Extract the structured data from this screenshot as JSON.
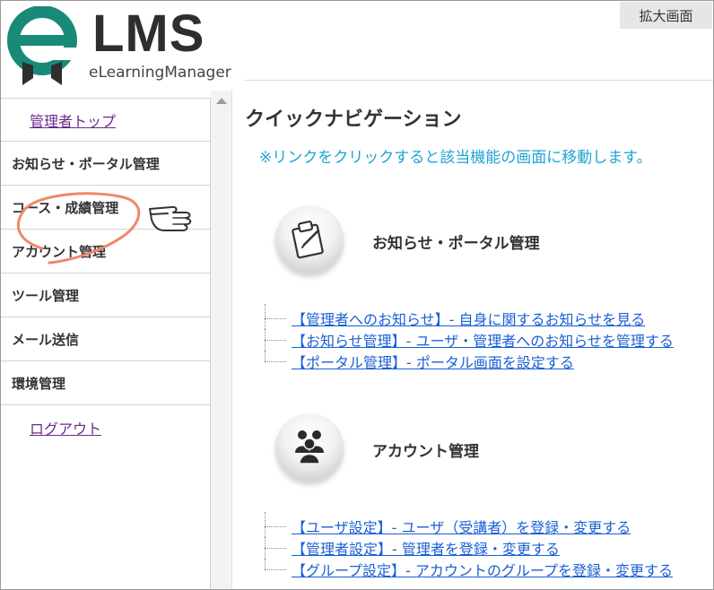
{
  "header": {
    "zoom_label": "拡大画面",
    "logo_text": "LMS",
    "logo_subtitle": "eLearningManager"
  },
  "sidebar": {
    "items": [
      {
        "label": "管理者トップ",
        "type": "link"
      },
      {
        "label": "お知らせ・ポータル管理",
        "type": "menu"
      },
      {
        "label": "コース・成績管理",
        "type": "menu"
      },
      {
        "label": "アカウント管理",
        "type": "menu"
      },
      {
        "label": "ツール管理",
        "type": "menu"
      },
      {
        "label": "メール送信",
        "type": "menu"
      },
      {
        "label": "環境管理",
        "type": "menu"
      },
      {
        "label": "ログアウト",
        "type": "link"
      }
    ]
  },
  "main": {
    "title": "クイックナビゲーション",
    "hint": "※リンクをクリックすると該当機能の画面に移動します。",
    "sections": [
      {
        "title": "お知らせ・ポータル管理",
        "icon": "clipboard-icon",
        "links": [
          "【管理者へのお知らせ】- 自身に関するお知らせを見る",
          "【お知らせ管理】- ユーザ・管理者へのお知らせを管理する",
          "【ポータル管理】- ポータル画面を設定する"
        ]
      },
      {
        "title": "アカウント管理",
        "icon": "users-group-icon",
        "links": [
          "【ユーザ設定】- ユーザ（受講者）を登録・変更する",
          "【管理者設定】- 管理者を登録・変更する",
          "【グループ設定】- アカウントのグループを登録・変更する"
        ]
      }
    ]
  },
  "colors": {
    "logo_teal": "#1a8a78",
    "logo_dark": "#2e2e2e",
    "link_blue": "#1a5fd6",
    "hint_blue": "#1fa3d6",
    "visited_purple": "#6b2a8a",
    "annotation_orange": "#f0876a"
  }
}
